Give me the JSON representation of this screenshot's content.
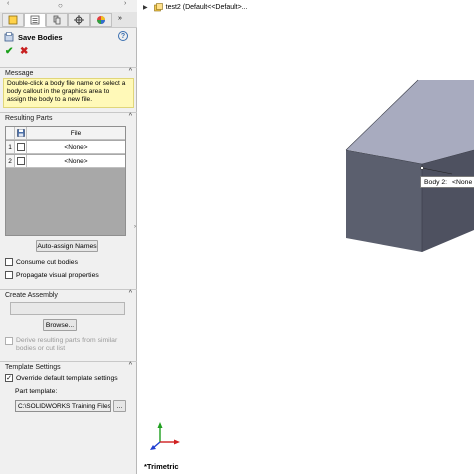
{
  "panel": {
    "title": "Save Bodies",
    "help_label": "?",
    "ok_icon": "check-icon",
    "cancel_icon": "x-icon",
    "tabs": [
      "feature-manager",
      "property-manager",
      "configuration-manager",
      "dimxpert-manager",
      "display-manager"
    ],
    "message": {
      "header": "Message",
      "text": "Double-click a body file name or select a body callout in the graphics area to assign the body to a new file."
    },
    "resulting_parts": {
      "header": "Resulting Parts",
      "column_file": "File",
      "rows": [
        {
          "index": "1",
          "file": "<None>"
        },
        {
          "index": "2",
          "file": "<None>"
        }
      ],
      "auto_assign_label": "Auto-assign Names",
      "consume_cut_bodies": "Consume cut bodies",
      "propagate_visual": "Propagate visual properties"
    },
    "create_assembly": {
      "header": "Create Assembly",
      "browse_label": "Browse...",
      "derive_label_line1": "Derive resulting parts from similar",
      "derive_label_line2": "bodies or cut list"
    },
    "template_settings": {
      "header": "Template Settings",
      "override_label": "Override default template settings",
      "part_template_label": "Part template:",
      "part_template_value": "C:\\SOLIDWORKS Training Files\\",
      "browse_small_label": "..."
    }
  },
  "graphics": {
    "tree_item": "test2  (Default<<Default>...",
    "callout_body": "Body  2:",
    "callout_none": "<None",
    "view_name": "*Trimetric",
    "colors": {
      "box_front": "#5b5f6e",
      "box_top": "#a8abbf",
      "box_right": "#4e5160",
      "axis_x": "#d02020",
      "axis_y": "#20a020",
      "axis_z": "#2040d0"
    }
  }
}
